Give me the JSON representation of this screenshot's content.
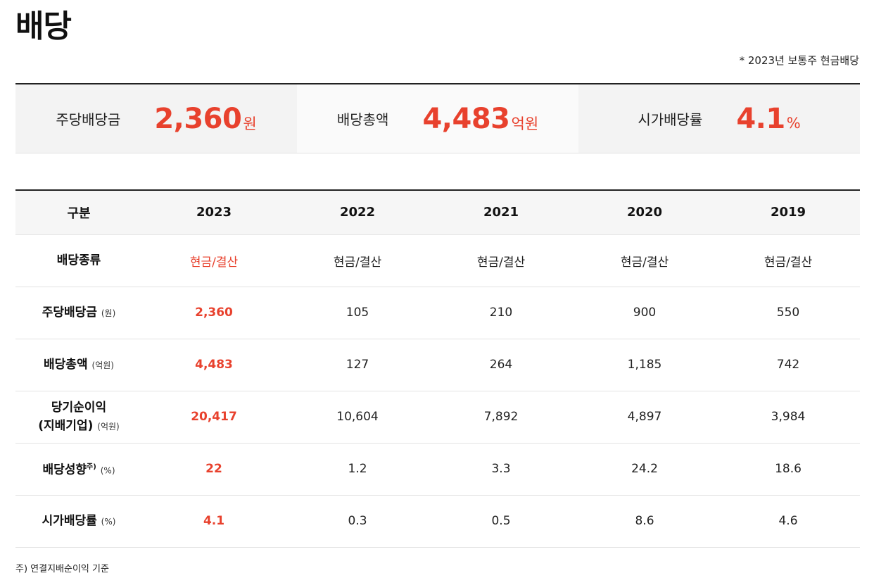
{
  "page": {
    "title": "배당",
    "note": "* 2023년 보통주 현금배당"
  },
  "summary": [
    {
      "label": "주당배당금",
      "value": "2,360",
      "unit": "원"
    },
    {
      "label": "배당총액",
      "value": "4,483",
      "unit": "억원"
    },
    {
      "label": "시가배당률",
      "value": "4.1",
      "unit": "%"
    }
  ],
  "table": {
    "headers": [
      "구분",
      "2023",
      "2022",
      "2021",
      "2020",
      "2019"
    ],
    "rows": [
      {
        "label": "배당종류",
        "label2": "",
        "unit": "",
        "footmark": "",
        "values": [
          "현금/결산",
          "현금/결산",
          "현금/결산",
          "현금/결산",
          "현금/결산"
        ]
      },
      {
        "label": "주당배당금",
        "label2": "",
        "unit": "(원)",
        "footmark": "",
        "values": [
          "2,360",
          "105",
          "210",
          "900",
          "550"
        ]
      },
      {
        "label": "배당총액",
        "label2": "",
        "unit": "(억원)",
        "footmark": "",
        "values": [
          "4,483",
          "127",
          "264",
          "1,185",
          "742"
        ]
      },
      {
        "label": "당기순이익",
        "label2": "(지배기업)",
        "unit": "(억원)",
        "footmark": "",
        "values": [
          "20,417",
          "10,604",
          "7,892",
          "4,897",
          "3,984"
        ]
      },
      {
        "label": "배당성향",
        "label2": "",
        "unit": "(%)",
        "footmark": "주)",
        "values": [
          "22",
          "1.2",
          "3.3",
          "24.2",
          "18.6"
        ]
      },
      {
        "label": "시가배당률",
        "label2": "",
        "unit": "(%)",
        "footmark": "",
        "values": [
          "4.1",
          "0.3",
          "0.5",
          "8.6",
          "4.6"
        ]
      }
    ]
  },
  "footnote": "주) 연결지배순이익 기준",
  "colors": {
    "accent": "#e8412d"
  }
}
